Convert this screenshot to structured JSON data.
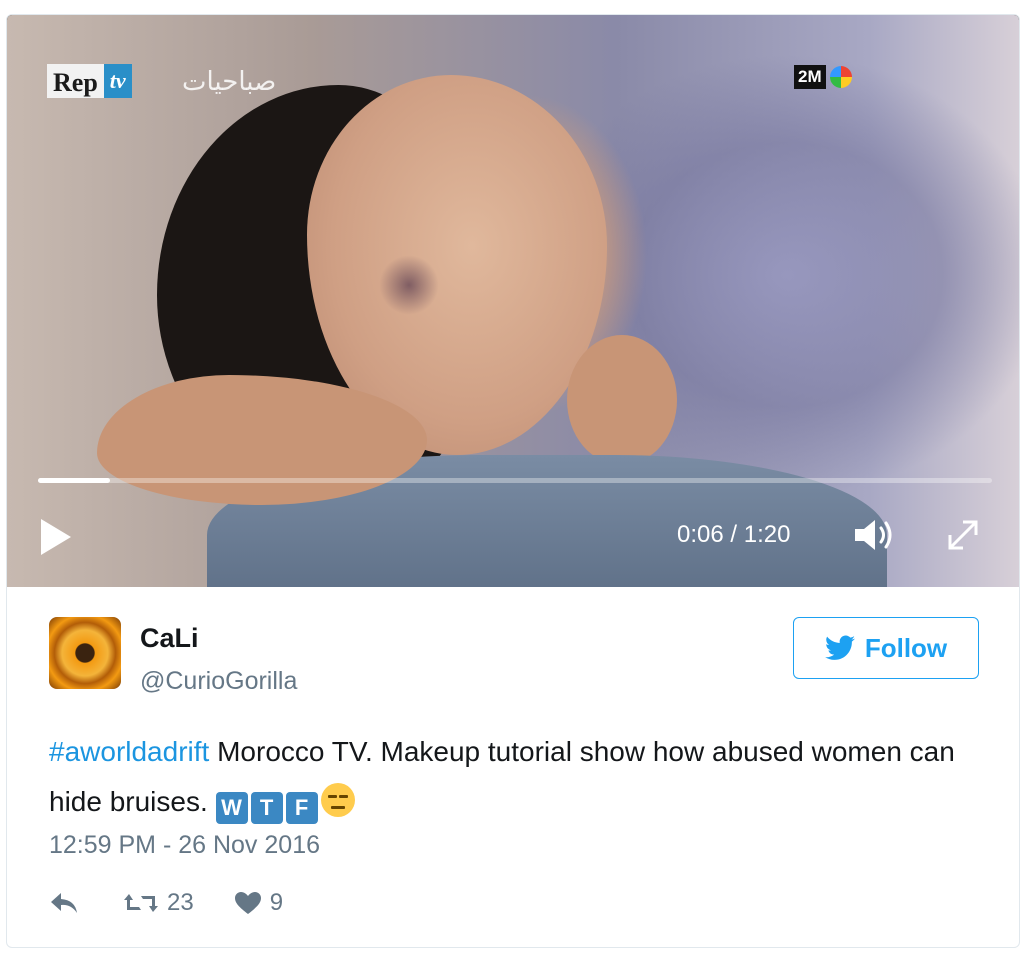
{
  "video": {
    "overlay_logo_left": "Rep",
    "overlay_logo_left_tv": "tv",
    "overlay_logo_arabic": "صباحيات",
    "overlay_logo_right": "2M",
    "time_display": "0:06 / 1:20",
    "progress_fraction": 0.075,
    "icons": {
      "play": "play-icon",
      "volume": "volume-icon",
      "fullscreen": "fullscreen-icon"
    }
  },
  "tweet": {
    "user": {
      "name": "CaLi",
      "handle": "@CurioGorilla"
    },
    "follow_label": "Follow",
    "hashtag": "#aworldadrift",
    "text": " Morocco TV. Makeup tutorial show how abused women can hide bruises. ",
    "emoji_letters": [
      "W",
      "T",
      "F"
    ],
    "timestamp": "12:59 PM - 26 Nov 2016",
    "retweet_count": "23",
    "like_count": "9"
  },
  "colors": {
    "accent": "#1da1f2",
    "hashtag": "#1b95e0",
    "muted": "#657786",
    "text": "#14171a"
  }
}
